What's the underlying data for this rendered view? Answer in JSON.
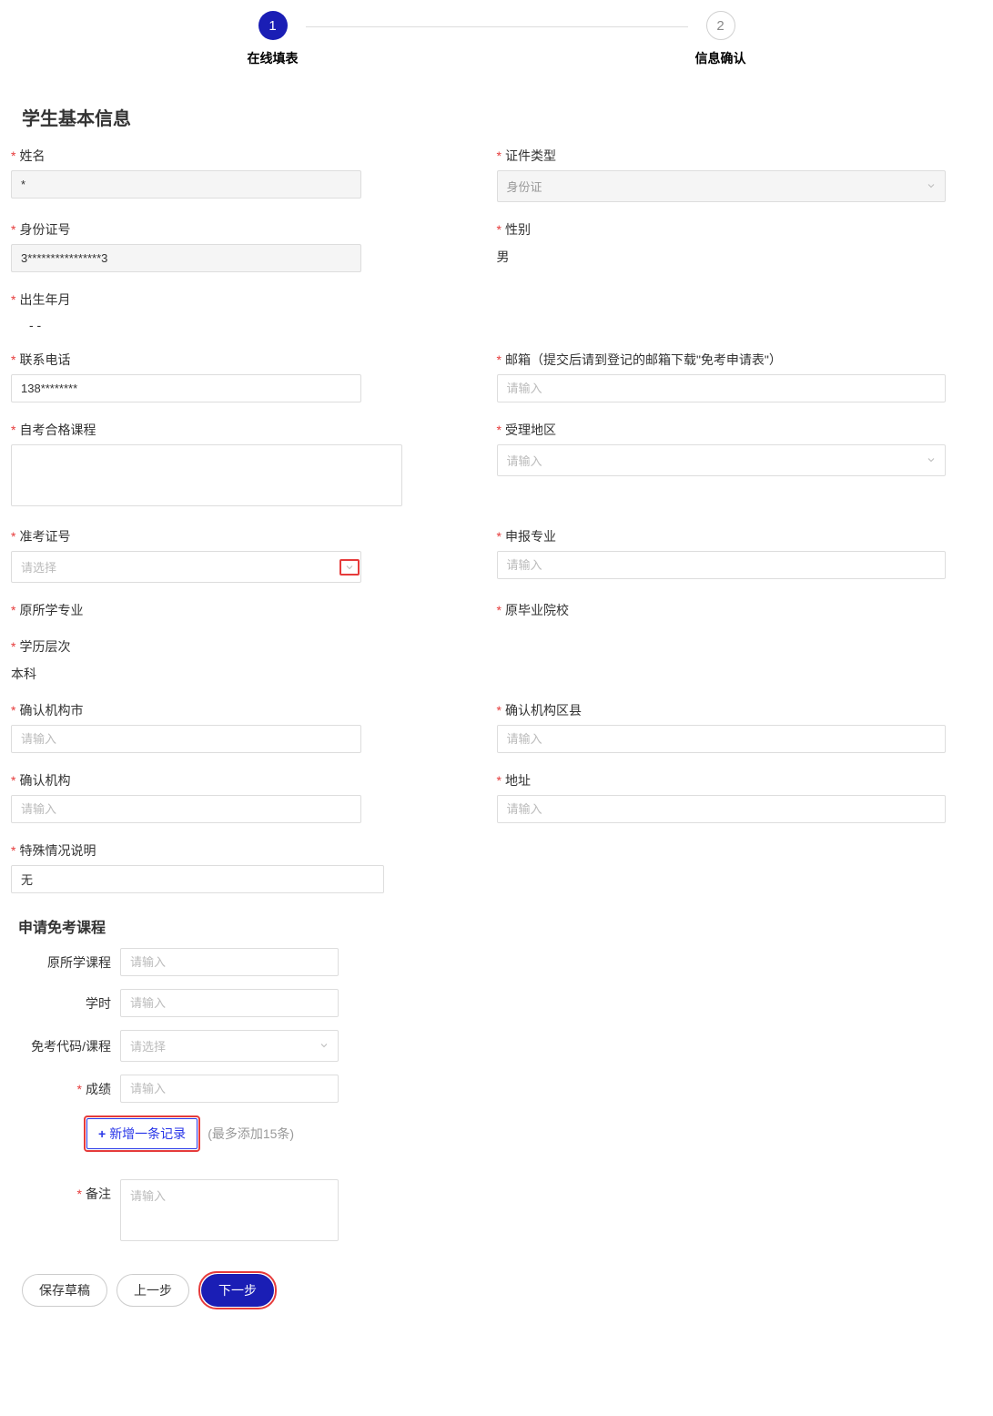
{
  "steps": {
    "s1": {
      "num": "1",
      "label": "在线填表"
    },
    "s2": {
      "num": "2",
      "label": "信息确认"
    }
  },
  "sections": {
    "basic_title": "学生基本信息",
    "exempt_title": "申请免考课程"
  },
  "fields": {
    "name": {
      "label": "姓名",
      "value": "*"
    },
    "cert_type": {
      "label": "证件类型",
      "value": "身份证"
    },
    "id_number": {
      "label": "身份证号",
      "value": "3****************3"
    },
    "gender": {
      "label": "性别",
      "value": "男"
    },
    "birth": {
      "label": "出生年月",
      "value": "- -"
    },
    "phone": {
      "label": "联系电话",
      "value": "138********"
    },
    "email": {
      "label": "邮箱（提交后请到登记的邮箱下载\"免考申请表\"）",
      "placeholder": "请输入"
    },
    "self_course": {
      "label": "自考合格课程"
    },
    "region": {
      "label": "受理地区",
      "placeholder": "请输入"
    },
    "exam_id": {
      "label": "准考证号",
      "placeholder": "请选择"
    },
    "declare_major": {
      "label": "申报专业",
      "placeholder": "请输入"
    },
    "orig_major": {
      "label": "原所学专业"
    },
    "orig_school": {
      "label": "原毕业院校"
    },
    "edu_level": {
      "label": "学历层次",
      "value": "本科"
    },
    "confirm_city": {
      "label": "确认机构市",
      "placeholder": "请输入"
    },
    "confirm_county": {
      "label": "确认机构区县",
      "placeholder": "请输入"
    },
    "confirm_org": {
      "label": "确认机构",
      "placeholder": "请输入"
    },
    "address": {
      "label": "地址",
      "placeholder": "请输入"
    },
    "special_note": {
      "label": "特殊情况说明",
      "value": "无"
    }
  },
  "sub_fields": {
    "orig_course": {
      "label": "原所学课程",
      "placeholder": "请输入"
    },
    "hours": {
      "label": "学时",
      "placeholder": "请输入"
    },
    "exempt_code": {
      "label": "免考代码/课程",
      "placeholder": "请选择"
    },
    "score": {
      "label": "成绩",
      "placeholder": "请输入"
    },
    "remark": {
      "label": "备注",
      "placeholder": "请输入"
    }
  },
  "add_record": {
    "label": "新增一条记录",
    "hint": "(最多添加15条)"
  },
  "actions": {
    "save_draft": "保存草稿",
    "prev": "上一步",
    "next": "下一步"
  }
}
